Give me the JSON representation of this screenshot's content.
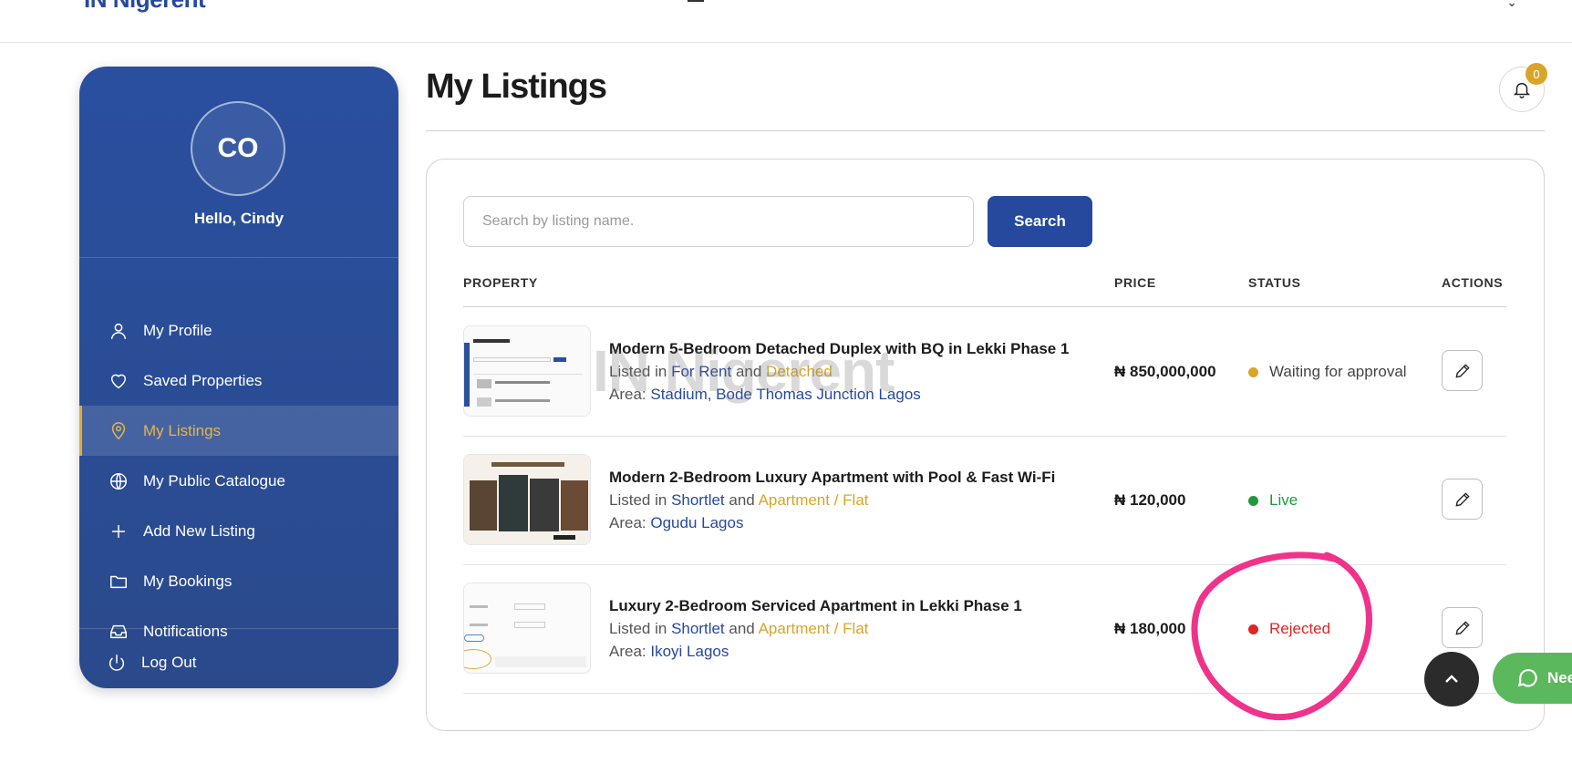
{
  "header": {
    "brand": "IN Nigerent"
  },
  "sidebar": {
    "avatar_initials": "CO",
    "greeting": "Hello, Cindy",
    "items": [
      {
        "label": "My Profile",
        "icon": "user-icon"
      },
      {
        "label": "Saved Properties",
        "icon": "heart-icon"
      },
      {
        "label": "My Listings",
        "icon": "map-pin-icon",
        "active": true
      },
      {
        "label": "My Public Catalogue",
        "icon": "globe-icon"
      },
      {
        "label": "Add New Listing",
        "icon": "plus-icon"
      },
      {
        "label": "My Bookings",
        "icon": "folder-icon"
      },
      {
        "label": "Notifications",
        "icon": "inbox-icon"
      }
    ],
    "logout": "Log Out"
  },
  "main": {
    "title": "My Listings",
    "notification_count": "0",
    "search": {
      "placeholder": "Search by listing name.",
      "button": "Search"
    },
    "columns": {
      "property": "PROPERTY",
      "price": "PRICE",
      "status": "STATUS",
      "actions": "ACTIONS"
    },
    "listings": [
      {
        "title": "Modern 5-Bedroom Detached Duplex with BQ in Lekki Phase 1",
        "listed_in_prefix": "Listed in",
        "category": "For Rent",
        "and": "and",
        "type": "Detached",
        "area_prefix": "Area:",
        "area": "Stadium, Bode Thomas Junction Lagos",
        "price": "₦ 850,000,000",
        "status": "Waiting for approval",
        "status_color": "#d8a52a"
      },
      {
        "title": "Modern 2-Bedroom Luxury Apartment with Pool & Fast Wi-Fi",
        "listed_in_prefix": "Listed in",
        "category": "Shortlet",
        "and": "and",
        "type": "Apartment / Flat",
        "area_prefix": "Area:",
        "area": "Ogudu Lagos",
        "price": "₦ 120,000",
        "status": "Live",
        "status_color": "#1e9a3c"
      },
      {
        "title": "Luxury 2-Bedroom Serviced Apartment in Lekki Phase 1",
        "listed_in_prefix": "Listed in",
        "category": "Shortlet",
        "and": "and",
        "type": "Apartment / Flat",
        "area_prefix": "Area:",
        "area": "Ikoyi Lagos",
        "price": "₦ 180,000",
        "status": "Rejected",
        "status_color": "#e02424"
      }
    ],
    "watermark": "IN Nigerent"
  },
  "floating": {
    "help_label": "Nee"
  },
  "colors": {
    "brand_blue": "#26499e",
    "gold": "#d8a52a",
    "help_green": "#5cb85c",
    "annotation_pink": "#f0338a"
  }
}
